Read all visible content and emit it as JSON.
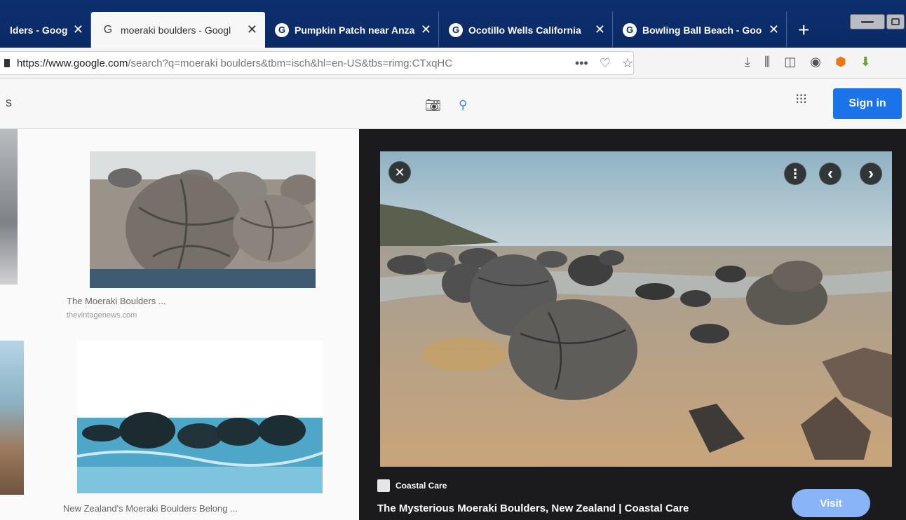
{
  "browser": {
    "tabs": [
      {
        "title": "lders - Googl",
        "favicon": "google-g-icon",
        "active": false
      },
      {
        "title": "moeraki boulders - Googl",
        "favicon": "google-g-icon",
        "active": true
      },
      {
        "title": "Pumpkin Patch near Anza",
        "favicon": "google-g-icon",
        "active": false
      },
      {
        "title": "Ocotillo Wells California",
        "favicon": "google-g-icon",
        "active": false
      },
      {
        "title": "Bowling Ball Beach - Goo",
        "favicon": "google-g-icon",
        "active": false
      }
    ],
    "new_tab_label": "+",
    "close_glyph": "✕",
    "favicon_glyph": "G",
    "url_domain": "https://www.google.com",
    "url_path": "/search?q=moeraki boulders&tbm=isch&hl=en-US&tbs=rimg:CTxqHC"
  },
  "google": {
    "header_partial": "s",
    "sign_in_label": "Sign in"
  },
  "results": [
    {
      "caption": "The Moeraki Boulders ...",
      "source": "thevintagenews.com"
    },
    {
      "caption": "New Zealand's Moeraki Boulders Belong ...",
      "source": ""
    }
  ],
  "preview": {
    "site_name": "Coastal Care",
    "title": "The Mysterious Moeraki Boulders, New Zealand | Coastal Care",
    "visit_label": "Visit",
    "close_glyph": "✕",
    "more_glyph": "⋮",
    "prev_glyph": "‹",
    "next_glyph": "›"
  },
  "colors": {
    "tabbar": "#0a2a66",
    "signin": "#1a73e8",
    "visit": "#8ab4f8"
  }
}
